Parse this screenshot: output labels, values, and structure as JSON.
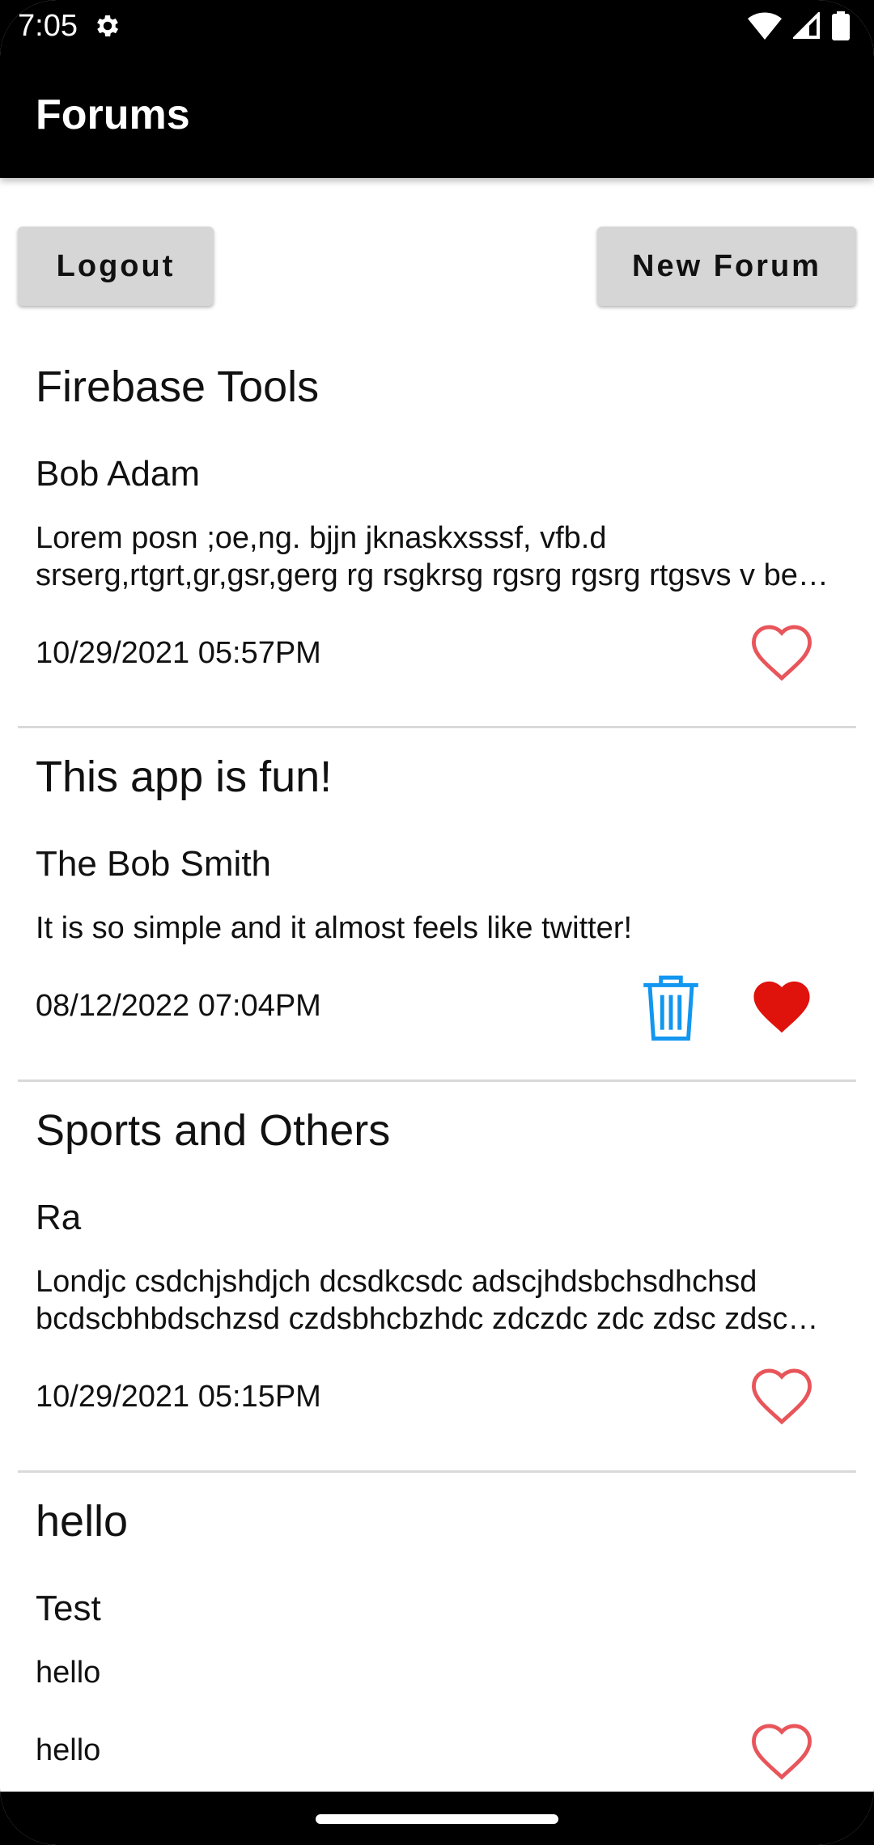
{
  "status_bar": {
    "time": "7:05",
    "icons": [
      "gear-icon",
      "wifi-icon",
      "signal-icon",
      "battery-icon"
    ]
  },
  "app_bar": {
    "title": "Forums"
  },
  "actions": {
    "logout_label": "Logout",
    "new_forum_label": "New Forum"
  },
  "forums": [
    {
      "title": "Firebase Tools",
      "author": "Bob Adam",
      "body": "Lorem posn ;oe,ng. bjjn jknaskxsssf, vfb.d srserg,rtgrt,gr,gsr,gerg rg rsgkrsg rgsrg rgsrg rtgsvs v bev g",
      "date": "10/29/2021 05:57PM",
      "liked": false,
      "deletable": false
    },
    {
      "title": "This app is fun!",
      "author": "The Bob Smith",
      "body": "It is so simple and it almost feels like twitter!",
      "date": "08/12/2022 07:04PM",
      "liked": true,
      "deletable": true
    },
    {
      "title": "Sports and Others",
      "author": "Ra",
      "body": "Londjc csdchjshdjch dcsdkcsdc adscjhdsbchsdhchsd bcdscbhbdschzsd czdsbhcbzhdc zdczdc zdc zdsc zdsc zdsc",
      "date": "10/29/2021 05:15PM",
      "liked": false,
      "deletable": false
    },
    {
      "title": "hello",
      "author": "Test",
      "body": "hello",
      "date": "hello",
      "liked": false,
      "deletable": false
    }
  ],
  "colors": {
    "heart_outline": "#e8555a",
    "heart_filled": "#e0120c",
    "trash": "#1296f0",
    "button_bg": "#d6d6d6",
    "bar_bg": "#000000"
  }
}
